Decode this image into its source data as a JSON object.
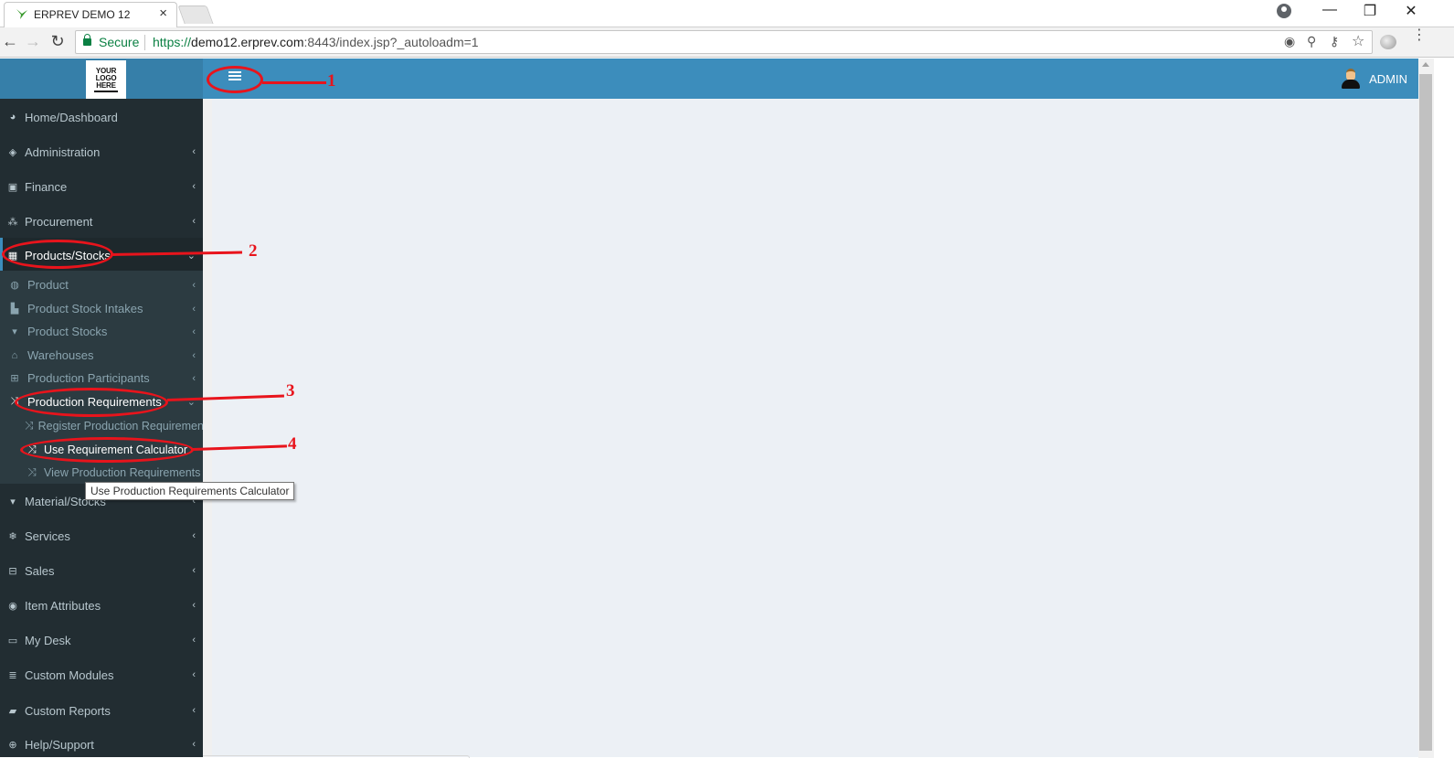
{
  "browser": {
    "tab_title": "ERPREV DEMO 12",
    "tab_close": "×",
    "secure_label": "Secure",
    "url_protocol": "https://",
    "url_host": "demo12.erprev.com",
    "url_rest": ":8443/index.jsp?_autoloadm=1",
    "nav": {
      "back": "←",
      "forward": "→",
      "reload": "↻"
    },
    "window_controls": {
      "minimize": "—",
      "restore": "❐",
      "close": "✕"
    },
    "omnibox_icons": {
      "location": "◉",
      "zoom": "⚲",
      "key": "⚷",
      "bookmark": "☆"
    },
    "menu": "⋮"
  },
  "header": {
    "logo_lines": [
      "YOUR",
      "LOGO",
      "HERE"
    ],
    "user_name": "ADMIN"
  },
  "sidebar": {
    "items": [
      {
        "label": "Home/Dashboard",
        "icon": "dashboard-icon",
        "glyph": "◕",
        "chevron": ""
      },
      {
        "label": "Administration",
        "icon": "ticket-icon",
        "glyph": "◈",
        "chevron": "‹"
      },
      {
        "label": "Finance",
        "icon": "money-icon",
        "glyph": "▣",
        "chevron": "‹"
      },
      {
        "label": "Procurement",
        "icon": "cubes-icon",
        "glyph": "⁂",
        "chevron": "‹"
      },
      {
        "label": "Products/Stocks",
        "icon": "building-icon",
        "glyph": "▦",
        "chevron": "⌄"
      },
      {
        "label": "Material/Stocks",
        "icon": "trash-icon",
        "glyph": "▾",
        "chevron": "‹"
      },
      {
        "label": "Services",
        "icon": "snowflake-icon",
        "glyph": "❄",
        "chevron": "‹"
      },
      {
        "label": "Sales",
        "icon": "cart-icon",
        "glyph": "⊟",
        "chevron": "‹"
      },
      {
        "label": "Item Attributes",
        "icon": "spotify-icon",
        "glyph": "◉",
        "chevron": "‹"
      },
      {
        "label": "My Desk",
        "icon": "desktop-icon",
        "glyph": "▭",
        "chevron": "‹"
      },
      {
        "label": "Custom Modules",
        "icon": "database-icon",
        "glyph": "≣",
        "chevron": "‹"
      },
      {
        "label": "Custom Reports",
        "icon": "book-icon",
        "glyph": "▰",
        "chevron": "‹"
      },
      {
        "label": "Help/Support",
        "icon": "life-ring-icon",
        "glyph": "⊕",
        "chevron": "‹"
      }
    ],
    "products_submenu": [
      {
        "label": "Product",
        "icon": "cube-icon",
        "glyph": "◍",
        "chevron": "‹"
      },
      {
        "label": "Product Stock Intakes",
        "icon": "truck-icon",
        "glyph": "▙",
        "chevron": "‹"
      },
      {
        "label": "Product Stocks",
        "icon": "bin-icon",
        "glyph": "▾",
        "chevron": "‹"
      },
      {
        "label": "Warehouses",
        "icon": "home-icon",
        "glyph": "⌂",
        "chevron": "‹"
      },
      {
        "label": "Production Participants",
        "icon": "sitemap-icon",
        "glyph": "⊞",
        "chevron": "‹"
      },
      {
        "label": "Production Requirements",
        "icon": "random-icon",
        "glyph": "⤨",
        "chevron": "⌄"
      }
    ],
    "requirements_submenu": [
      {
        "label": "Register Production Requirements",
        "icon": "random-icon",
        "glyph": "⤨"
      },
      {
        "label": "Use Requirement Calculator",
        "icon": "random-icon",
        "glyph": "⤨"
      },
      {
        "label": "View Production Requirements",
        "icon": "random-icon",
        "glyph": "⤨"
      }
    ]
  },
  "tooltip": "Use Production Requirements Calculator",
  "annotations": [
    "1",
    "2",
    "3",
    "4"
  ],
  "colors": {
    "header": "#3c8dbc",
    "logo_area": "#367fa9",
    "sidebar": "#222d32",
    "submenu": "#2c3b41",
    "content": "#ecf0f5",
    "annotation": "#e8141c"
  }
}
